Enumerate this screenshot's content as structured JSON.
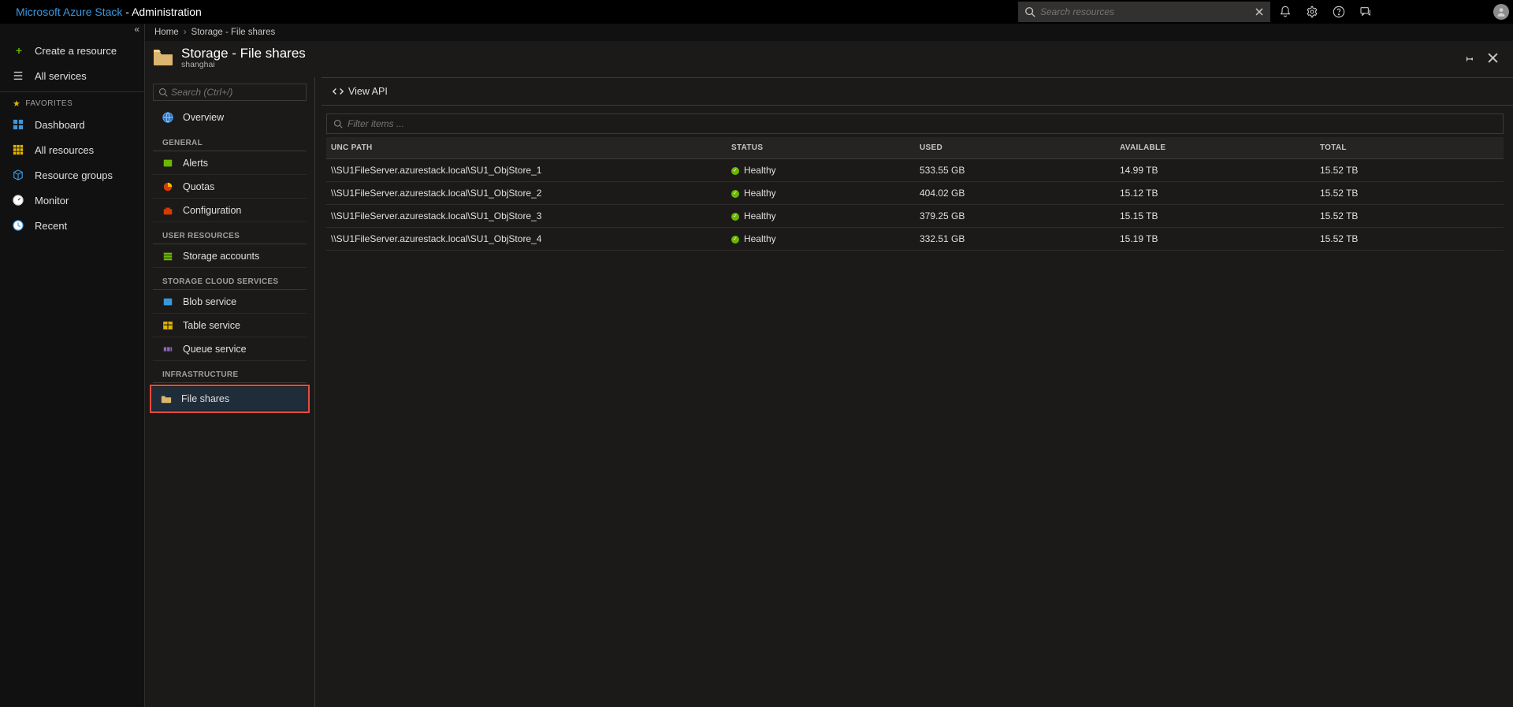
{
  "topbar": {
    "product": "Microsoft Azure Stack",
    "tenant_sep": " - ",
    "tenant": "Administration",
    "search_placeholder": "Search resources"
  },
  "leftnav": {
    "create": "Create a resource",
    "all_services": "All services",
    "favorites_label": "FAVORITES",
    "items": [
      {
        "label": "Dashboard"
      },
      {
        "label": "All resources"
      },
      {
        "label": "Resource groups"
      },
      {
        "label": "Monitor"
      },
      {
        "label": "Recent"
      }
    ]
  },
  "breadcrumb": {
    "home": "Home",
    "current": "Storage - File shares"
  },
  "bladeHeader": {
    "title": "Storage - File shares",
    "subtitle": "shanghai"
  },
  "bladeMenu": {
    "search_placeholder": "Search (Ctrl+/)",
    "overview": "Overview",
    "sections": {
      "general": {
        "header": "GENERAL",
        "items": [
          {
            "label": "Alerts"
          },
          {
            "label": "Quotas"
          },
          {
            "label": "Configuration"
          }
        ]
      },
      "user_resources": {
        "header": "USER RESOURCES",
        "items": [
          {
            "label": "Storage accounts"
          }
        ]
      },
      "storage_cloud": {
        "header": "STORAGE CLOUD SERVICES",
        "items": [
          {
            "label": "Blob service"
          },
          {
            "label": "Table service"
          },
          {
            "label": "Queue service"
          }
        ]
      },
      "infrastructure": {
        "header": "INFRASTRUCTURE",
        "items": [
          {
            "label": "File shares",
            "selected": true
          }
        ]
      }
    }
  },
  "commandBar": {
    "view_api": "View API"
  },
  "table": {
    "filter_placeholder": "Filter items ...",
    "columns": {
      "unc": "UNC PATH",
      "status": "STATUS",
      "used": "USED",
      "available": "AVAILABLE",
      "total": "TOTAL"
    },
    "rows": [
      {
        "unc": "\\\\SU1FileServer.azurestack.local\\SU1_ObjStore_1",
        "status": "Healthy",
        "used": "533.55 GB",
        "available": "14.99 TB",
        "total": "15.52 TB"
      },
      {
        "unc": "\\\\SU1FileServer.azurestack.local\\SU1_ObjStore_2",
        "status": "Healthy",
        "used": "404.02 GB",
        "available": "15.12 TB",
        "total": "15.52 TB"
      },
      {
        "unc": "\\\\SU1FileServer.azurestack.local\\SU1_ObjStore_3",
        "status": "Healthy",
        "used": "379.25 GB",
        "available": "15.15 TB",
        "total": "15.52 TB"
      },
      {
        "unc": "\\\\SU1FileServer.azurestack.local\\SU1_ObjStore_4",
        "status": "Healthy",
        "used": "332.51 GB",
        "available": "15.19 TB",
        "total": "15.52 TB"
      }
    ]
  },
  "colors": {
    "accent_link": "#3a96dd",
    "healthy_green": "#6bb700",
    "highlight_red": "#e74c3c",
    "panel_bg": "#1b1a19"
  }
}
